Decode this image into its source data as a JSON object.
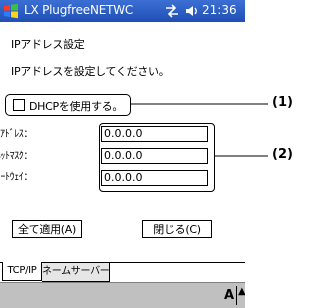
{
  "window": {
    "title": "LX PlugfreeNETWC",
    "clock": "21:36"
  },
  "dialog": {
    "heading": "IPアドレス設定",
    "instruction": "IPアドレスを設定してください。",
    "dhcp": {
      "label": "DHCPを使用する。",
      "checked": false
    },
    "fields": {
      "ip_label": "IPｱﾄﾞﾚｽ：",
      "ip_value": "0.0.0.0",
      "mask_label": "ｻﾌﾞﾈｯﾄﾏｽｸ：",
      "mask_value": "0.0.0.0",
      "gateway_label": "規定のｹﾞｰﾄｳｪｲ：",
      "gateway_value": "0.0.0.0"
    },
    "buttons": {
      "apply_all": "全て適用(A)",
      "close": "閉じる(C)"
    }
  },
  "tabs": [
    {
      "label": "TCP/IP",
      "active": true
    },
    {
      "label": "ネームサーバー",
      "active": false
    }
  ],
  "sip": {
    "indicator": "A",
    "arrow": "▲"
  },
  "callouts": {
    "c1": "(1)",
    "c2": "(2)"
  },
  "icons": {
    "title": "windows-flag-icon",
    "connection": "connectivity-icon",
    "volume": "speaker-icon"
  }
}
